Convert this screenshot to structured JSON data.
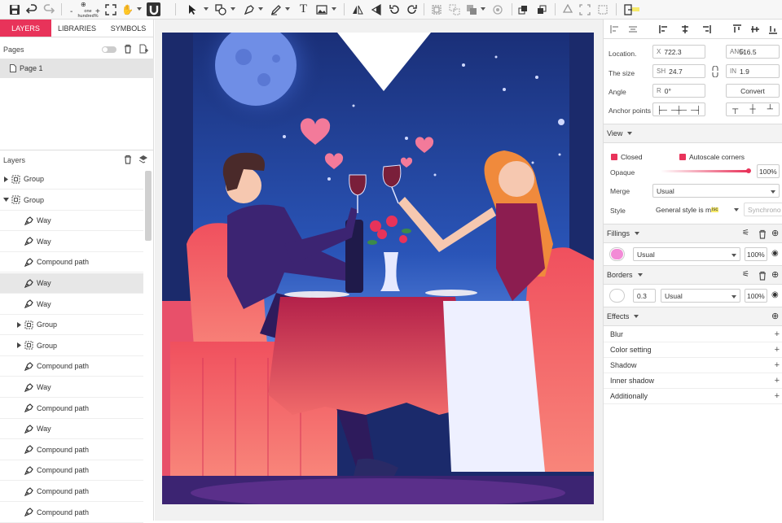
{
  "toolbar": {
    "zoom_label": "one hundred%"
  },
  "left": {
    "tabs": [
      "LAYERS",
      "LIBRARIES",
      "SYMBOLS"
    ],
    "pages_label": "Pages",
    "page_item": "Page 1",
    "layers_label": "Layers",
    "layers": [
      {
        "label": "Group",
        "indent": 0,
        "expander": "right"
      },
      {
        "label": "Group",
        "indent": 0,
        "expander": "down"
      },
      {
        "label": "Way",
        "indent": 1,
        "expander": ""
      },
      {
        "label": "Way",
        "indent": 1,
        "expander": ""
      },
      {
        "label": "Compound path",
        "indent": 1,
        "expander": ""
      },
      {
        "label": "Way",
        "indent": 1,
        "expander": "",
        "selected": true
      },
      {
        "label": "Way",
        "indent": 1,
        "expander": ""
      },
      {
        "label": "Group",
        "indent": 1,
        "expander": "right"
      },
      {
        "label": "Group",
        "indent": 1,
        "expander": "right"
      },
      {
        "label": "Compound path",
        "indent": 1,
        "expander": ""
      },
      {
        "label": "Way",
        "indent": 1,
        "expander": ""
      },
      {
        "label": "Compound path",
        "indent": 1,
        "expander": ""
      },
      {
        "label": "Way",
        "indent": 1,
        "expander": ""
      },
      {
        "label": "Compound path",
        "indent": 1,
        "expander": ""
      },
      {
        "label": "Compound path",
        "indent": 1,
        "expander": ""
      },
      {
        "label": "Compound path",
        "indent": 1,
        "expander": ""
      },
      {
        "label": "Compound path",
        "indent": 1,
        "expander": ""
      }
    ]
  },
  "right": {
    "location_label": "Location.",
    "x_prefix": "X",
    "x_value": "722.3",
    "angle_prefix": "ANG",
    "y_value": "516.5",
    "size_label": "The size",
    "sh_prefix": "SH",
    "sh_value": "24.7",
    "in_prefix": "IN",
    "in_value": "1.9",
    "angle_label": "Angle",
    "r_prefix": "R",
    "r_value": "0°",
    "convert_label": "Convert",
    "anchor_label": "Anchor points",
    "view_label": "View",
    "closed_label": "Closed",
    "autoscale_label": "Autoscale corners",
    "opaque_label": "Opaque",
    "opaque_value": "100%",
    "merge_label": "Merge",
    "merge_value": "Usual",
    "style_label": "Style",
    "style_value": "General style is m",
    "style_badge": "isc",
    "synchro_label": "Synchrono",
    "fillings_label": "Fillings",
    "fill_mode": "Usual",
    "fill_opacity": "100%",
    "fill_color": "#f28bd6",
    "borders_label": "Borders",
    "border_width": "0.3",
    "border_mode": "Usual",
    "border_opacity": "100%",
    "effects_label": "Effects",
    "effects": [
      "Blur",
      "Color setting",
      "Shadow",
      "Inner shadow",
      "Additionally"
    ]
  },
  "colors": {
    "accent": "#e8335a",
    "night_sky": "#1f3b8a",
    "moon": "#6f8ee6",
    "chair": "#f2505e",
    "tablecloth": "#d42f55"
  }
}
